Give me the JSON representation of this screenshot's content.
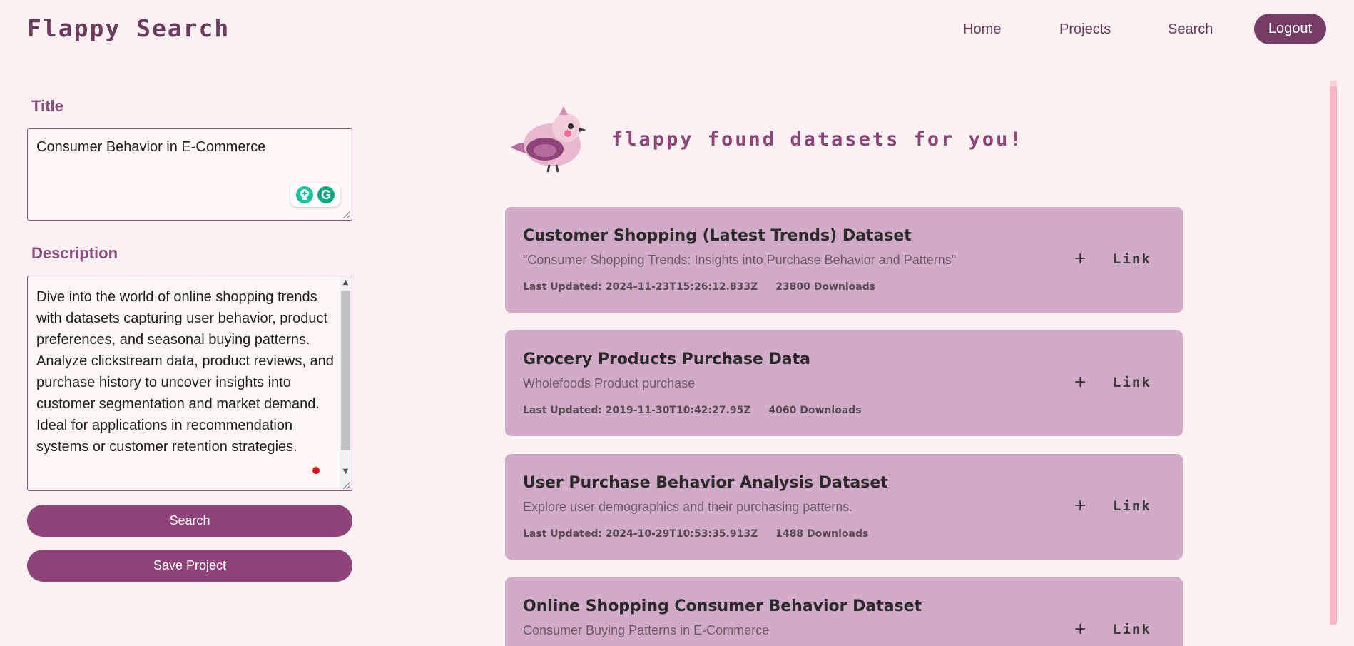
{
  "header": {
    "brand": "Flappy Search",
    "nav": [
      {
        "label": "Home"
      },
      {
        "label": "Projects"
      },
      {
        "label": "Search"
      }
    ],
    "logout_label": "Logout"
  },
  "form": {
    "title_label": "Title",
    "title_value": "Consumer Behavior in E-Commerce",
    "description_label": "Description",
    "description_value": "Dive into the world of online shopping trends with datasets capturing user behavior, product preferences, and seasonal buying patterns. Analyze clickstream data, product reviews, and purchase history to uncover insights into customer segmentation and market demand. Ideal for applications in recommendation systems or customer retention strategies.",
    "search_label": "Search",
    "save_label": "Save Project"
  },
  "results": {
    "headline": "flappy found datasets for you!",
    "add_symbol": "+",
    "link_label": "Link",
    "items": [
      {
        "title": "Customer Shopping (Latest Trends) Dataset",
        "subtitle": "\"Consumer Shopping Trends: Insights into Purchase Behavior and Patterns\"",
        "updated": "Last Updated: 2024-11-23T15:26:12.833Z",
        "downloads": "23800 Downloads"
      },
      {
        "title": "Grocery Products Purchase Data",
        "subtitle": "Wholefoods Product purchase",
        "updated": "Last Updated: 2019-11-30T10:42:27.95Z",
        "downloads": "4060 Downloads"
      },
      {
        "title": "User Purchase Behavior Analysis Dataset",
        "subtitle": "Explore user demographics and their purchasing patterns.",
        "updated": "Last Updated: 2024-10-29T10:53:35.913Z",
        "downloads": "1488 Downloads"
      },
      {
        "title": "Online Shopping Consumer Behavior Dataset",
        "subtitle": "Consumer Buying Patterns in E-Commerce",
        "updated": "",
        "downloads": ""
      }
    ]
  },
  "colors": {
    "background": "#fdf2f1",
    "accent": "#8e4479",
    "brand": "#6b3a5e",
    "card": "#d1abc8"
  }
}
